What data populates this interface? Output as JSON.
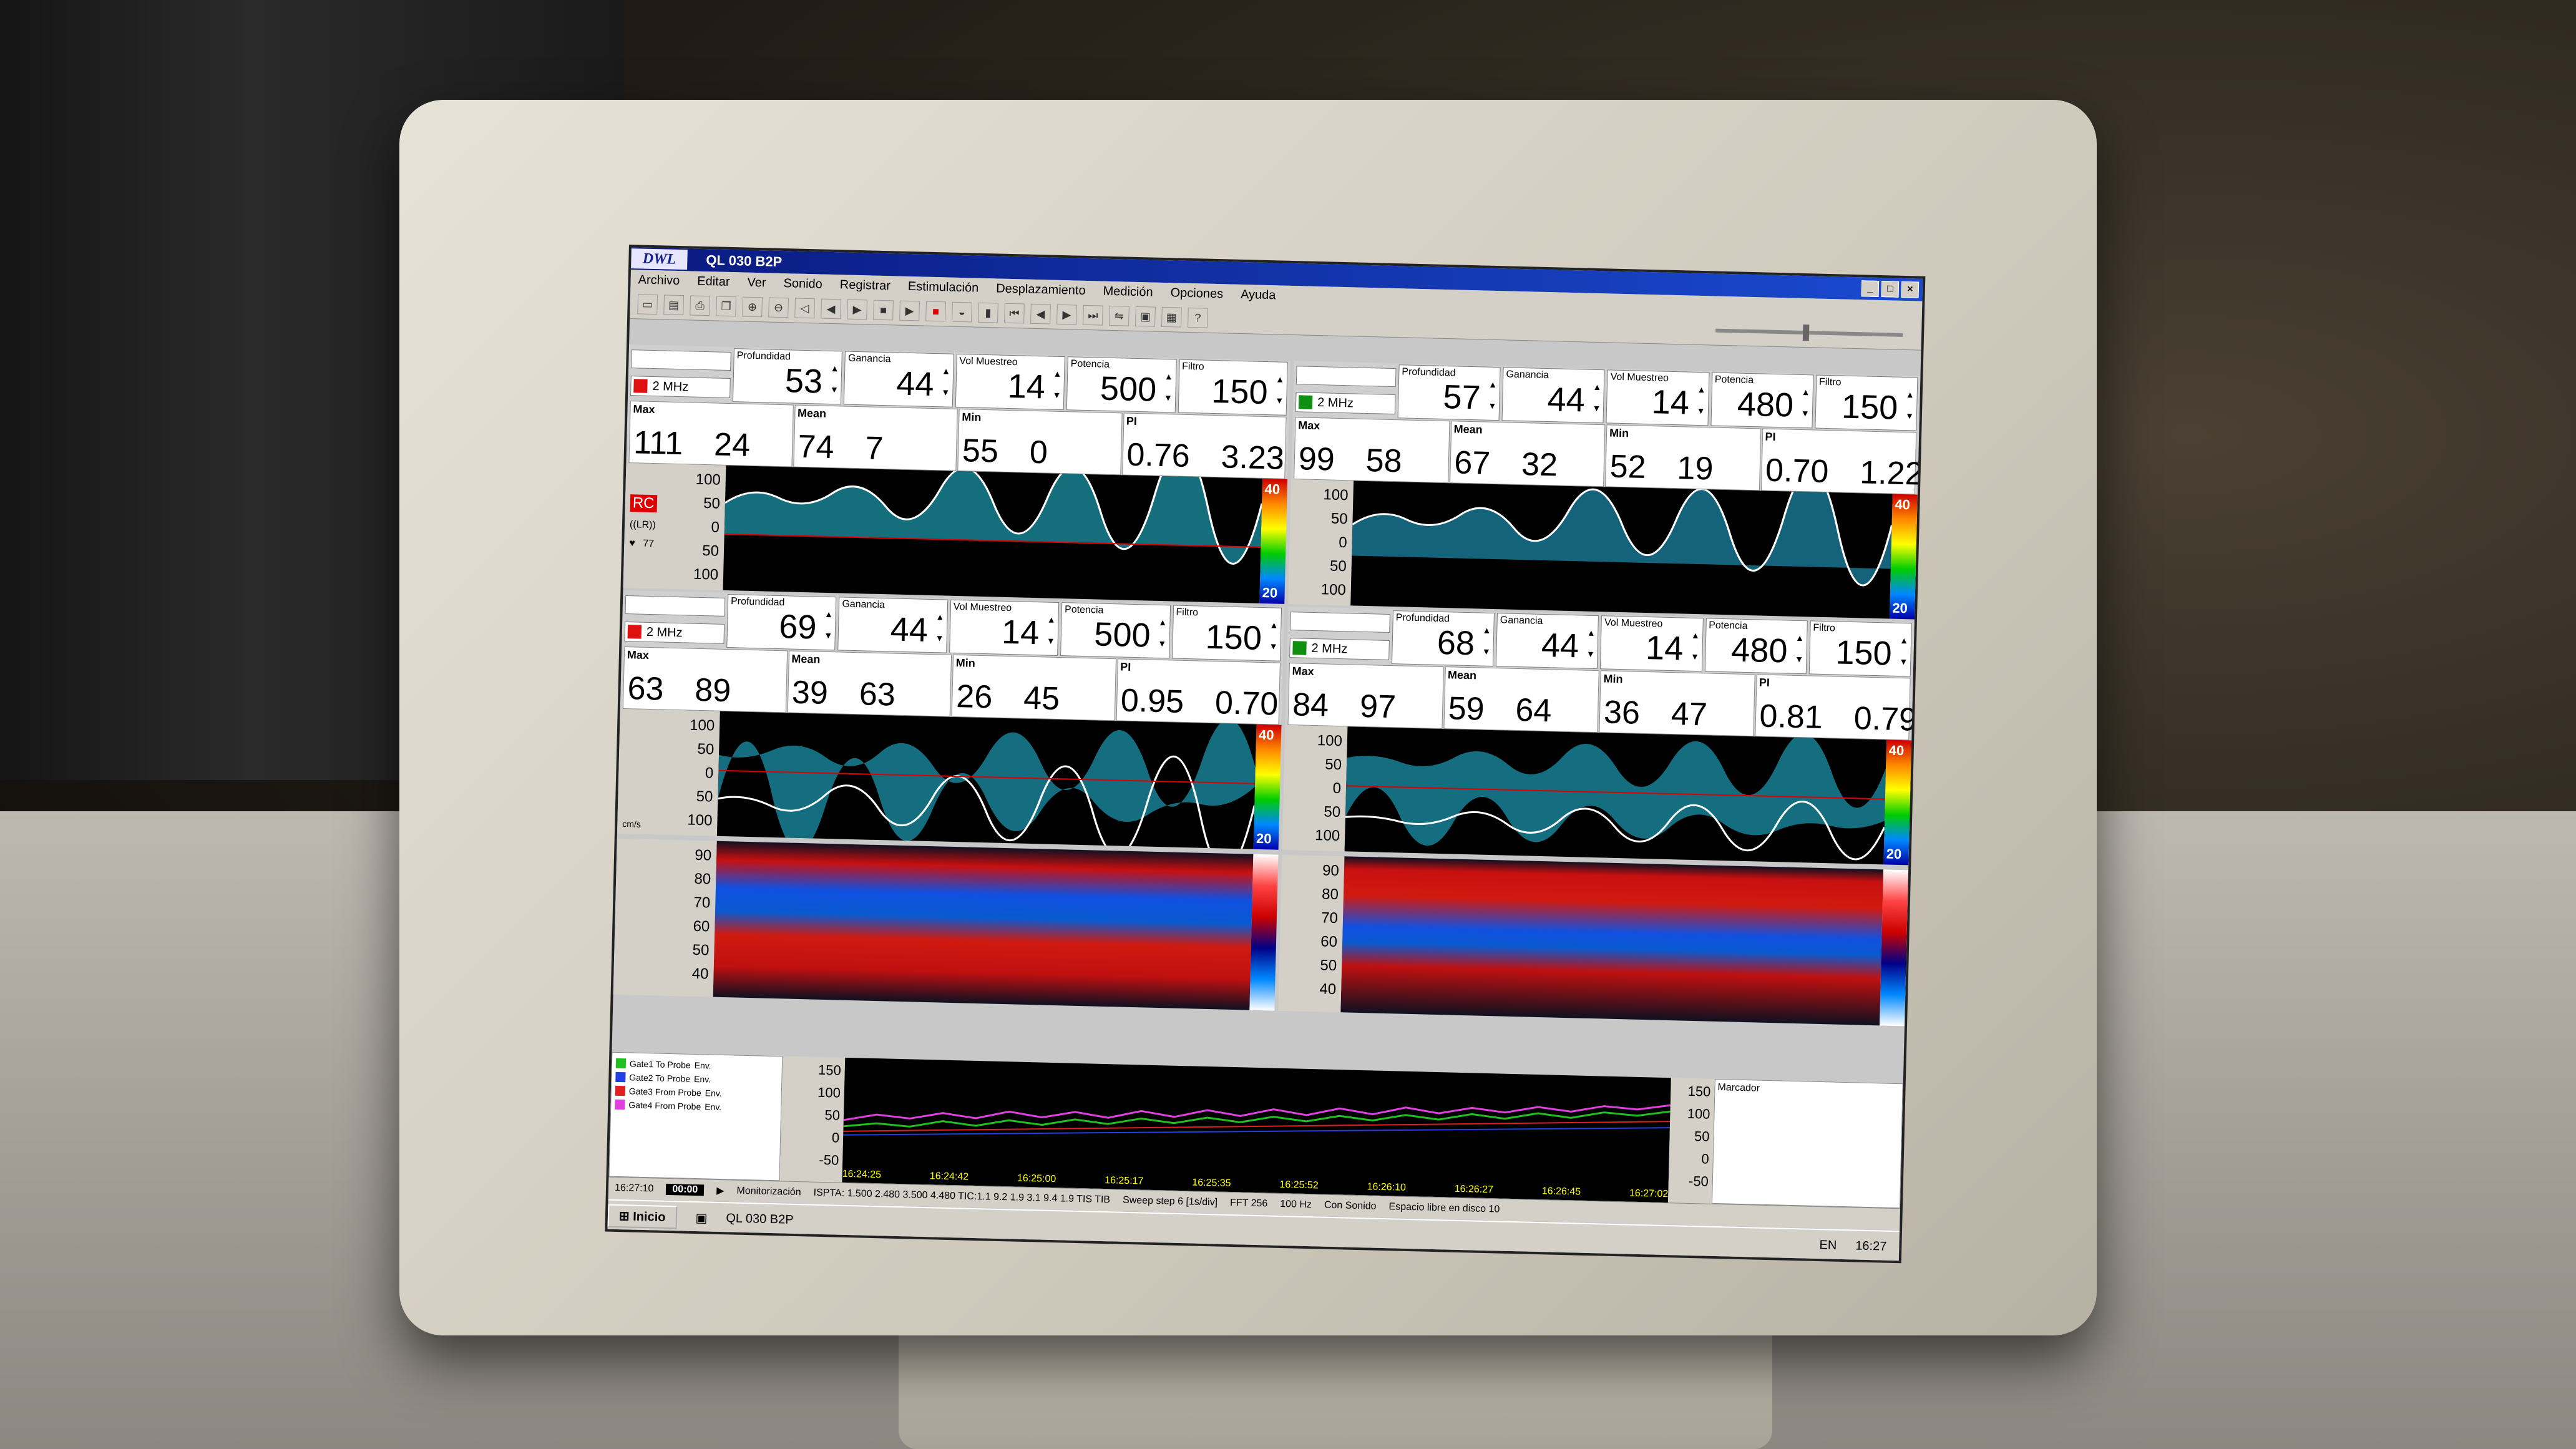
{
  "window": {
    "title": "QL 030 B2P",
    "logo": "DWL"
  },
  "menu": [
    "Archivo",
    "Editar",
    "Ver",
    "Sonido",
    "Registrar",
    "Estimulación",
    "Desplazamiento",
    "Medición",
    "Opciones",
    "Ayuda"
  ],
  "colors": {
    "red": "#e01010",
    "green": "#109010"
  },
  "channels": [
    {
      "freq": "2 MHz",
      "color": "#e01010",
      "params": [
        {
          "label": "Profundidad",
          "value": "53"
        },
        {
          "label": "Ganancia",
          "value": "44"
        },
        {
          "label": "Vol Muestreo",
          "value": "14"
        },
        {
          "label": "Potencia",
          "value": "500"
        },
        {
          "label": "Filtro",
          "value": "150"
        }
      ],
      "stats": [
        {
          "label": "Max",
          "a": "111",
          "b": "24"
        },
        {
          "label": "Mean",
          "a": "74",
          "b": "7"
        },
        {
          "label": "Min",
          "a": "55",
          "b": "0"
        },
        {
          "label": "PI",
          "a": "0.76",
          "b": "3.23"
        }
      ]
    },
    {
      "freq": "2 MHz",
      "color": "#109010",
      "params": [
        {
          "label": "Profundidad",
          "value": "57"
        },
        {
          "label": "Ganancia",
          "value": "44"
        },
        {
          "label": "Vol Muestreo",
          "value": "14"
        },
        {
          "label": "Potencia",
          "value": "480"
        },
        {
          "label": "Filtro",
          "value": "150"
        }
      ],
      "stats": [
        {
          "label": "Max",
          "a": "99",
          "b": "58"
        },
        {
          "label": "Mean",
          "a": "67",
          "b": "32"
        },
        {
          "label": "Min",
          "a": "52",
          "b": "19"
        },
        {
          "label": "PI",
          "a": "0.70",
          "b": "1.22"
        }
      ]
    },
    {
      "freq": "2 MHz",
      "color": "#e01010",
      "params": [
        {
          "label": "Profundidad",
          "value": "69"
        },
        {
          "label": "Ganancia",
          "value": "44"
        },
        {
          "label": "Vol Muestreo",
          "value": "14"
        },
        {
          "label": "Potencia",
          "value": "500"
        },
        {
          "label": "Filtro",
          "value": "150"
        }
      ],
      "stats": [
        {
          "label": "Max",
          "a": "63",
          "b": "89"
        },
        {
          "label": "Mean",
          "a": "39",
          "b": "63"
        },
        {
          "label": "Min",
          "a": "26",
          "b": "45"
        },
        {
          "label": "PI",
          "a": "0.95",
          "b": "0.70"
        }
      ]
    },
    {
      "freq": "2 MHz",
      "color": "#109010",
      "params": [
        {
          "label": "Profundidad",
          "value": "68"
        },
        {
          "label": "Ganancia",
          "value": "44"
        },
        {
          "label": "Vol Muestreo",
          "value": "14"
        },
        {
          "label": "Potencia",
          "value": "480"
        },
        {
          "label": "Filtro",
          "value": "150"
        }
      ],
      "stats": [
        {
          "label": "Max",
          "a": "84",
          "b": "97"
        },
        {
          "label": "Mean",
          "a": "59",
          "b": "64"
        },
        {
          "label": "Min",
          "a": "36",
          "b": "47"
        },
        {
          "label": "PI",
          "a": "0.81",
          "b": "0.79"
        }
      ]
    }
  ],
  "spectrum_scale": [
    "100",
    "50",
    "0",
    "50",
    "100"
  ],
  "colorbar": {
    "top": "40",
    "bottom": "20"
  },
  "side_labels": {
    "rc": "RC",
    "lr": "((LR))",
    "hr": "77",
    "unit": "cm/s"
  },
  "mmode_scale": [
    "90",
    "80",
    "70",
    "60",
    "50",
    "40"
  ],
  "legend": [
    {
      "label": "Gate1 To Probe",
      "env": "Env.",
      "color": "#20c020"
    },
    {
      "label": "Gate2 To Probe",
      "env": "Env.",
      "color": "#2040e0"
    },
    {
      "label": "Gate3 From Probe",
      "env": "Env.",
      "color": "#e02020"
    },
    {
      "label": "Gate4 From Probe",
      "env": "Env.",
      "color": "#e040e0"
    }
  ],
  "trend_scale": [
    "150",
    "100",
    "50",
    "0",
    "-50"
  ],
  "trend_times": [
    "16:24:25",
    "16:24:42",
    "16:25:00",
    "16:25:17",
    "16:25:35",
    "16:25:52",
    "16:26:10",
    "16:26:27",
    "16:26:45",
    "16:27:02"
  ],
  "marcador": {
    "title": "Marcador",
    "scale": [
      "150",
      "100",
      "50",
      "0",
      "-50"
    ]
  },
  "status": {
    "time": "16:27:10",
    "clock": "00:00",
    "mode": "Monitorización",
    "ispta": "ISPTA: 1.500 2.480 3.500 4.480 TIC:1.1 9.2 1.9 3.1 9.4 1.9 TIS TIB",
    "sweep": "Sweep step 6 [1s/div]",
    "fft": "FFT 256",
    "hz": "100 Hz",
    "sound": "Con Sonido",
    "disk": "Espacio libre en disco 10"
  },
  "taskbar": {
    "start": "Inicio",
    "task": "QL 030 B2P",
    "lang": "EN",
    "clock": "16:27"
  }
}
